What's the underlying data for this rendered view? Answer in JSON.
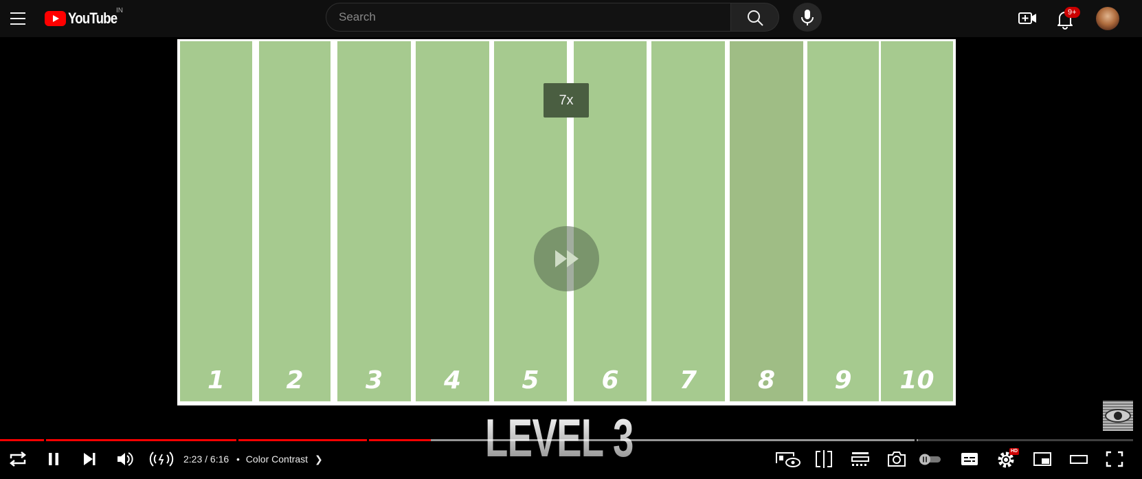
{
  "header": {
    "logo_text": "YouTube",
    "country_code": "IN",
    "search_placeholder": "Search",
    "notification_count": "9+"
  },
  "video": {
    "bars": [
      {
        "label": "1"
      },
      {
        "label": "2"
      },
      {
        "label": "3"
      },
      {
        "label": "4"
      },
      {
        "label": "5"
      },
      {
        "label": "6"
      },
      {
        "label": "7"
      },
      {
        "label": "8"
      },
      {
        "label": "9"
      },
      {
        "label": "10"
      }
    ],
    "speed_label": "7x",
    "level_title": "LEVEL 3",
    "colors": {
      "bar": "#a6ca8f",
      "odd_bar": "#9fbd85"
    }
  },
  "player": {
    "current_time": "2:23",
    "duration": "6:16",
    "time_display": "2:23 / 6:16",
    "chapter_separator": "•",
    "chapter_title": "Color Contrast",
    "progress_fraction": 0.38,
    "buffer_fraction": 0.81,
    "hd_badge": "HD"
  },
  "icons": {
    "menu": "hamburger-icon",
    "search": "search-icon",
    "mic": "mic-icon",
    "create": "create-video-icon",
    "bell": "bell-icon",
    "loop": "loop-icon",
    "pause": "pause-icon",
    "next": "next-icon",
    "volume": "volume-icon",
    "ambient": "stable-volume-icon",
    "settings": "gear-icon"
  }
}
